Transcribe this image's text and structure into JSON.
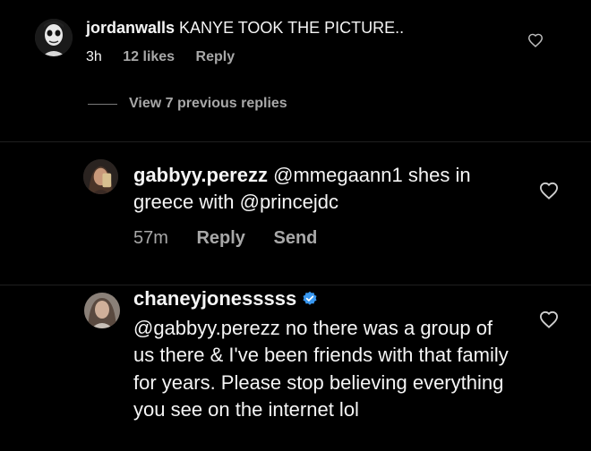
{
  "comments": [
    {
      "username": "jordanwalls",
      "text": "KANYE TOOK THE PICTURE..",
      "time": "3h",
      "likes": "12 likes",
      "reply": "Reply",
      "view_previous": "View 7 previous replies",
      "avatar_icon": "masked-face-avatar"
    },
    {
      "username": "gabbyy.perezz",
      "text": "@mmegaann1 shes in greece with @princejdc",
      "time": "57m",
      "reply": "Reply",
      "send": "Send",
      "avatar_icon": "selfie-avatar"
    },
    {
      "username": "chaneyjonesssss",
      "verified": true,
      "text": "@gabbyy.perezz no there was a group of us there & I've been friends with that family for years. Please stop believing everything you see on the internet lol",
      "avatar_icon": "profile-avatar"
    }
  ],
  "icons": {
    "like": "heart-outline-icon",
    "verified": "verified-badge-icon"
  },
  "colors": {
    "background": "#000000",
    "primary_text": "#f5f5f5",
    "secondary_text": "#a8a8a8",
    "verified": "#3897f0"
  }
}
